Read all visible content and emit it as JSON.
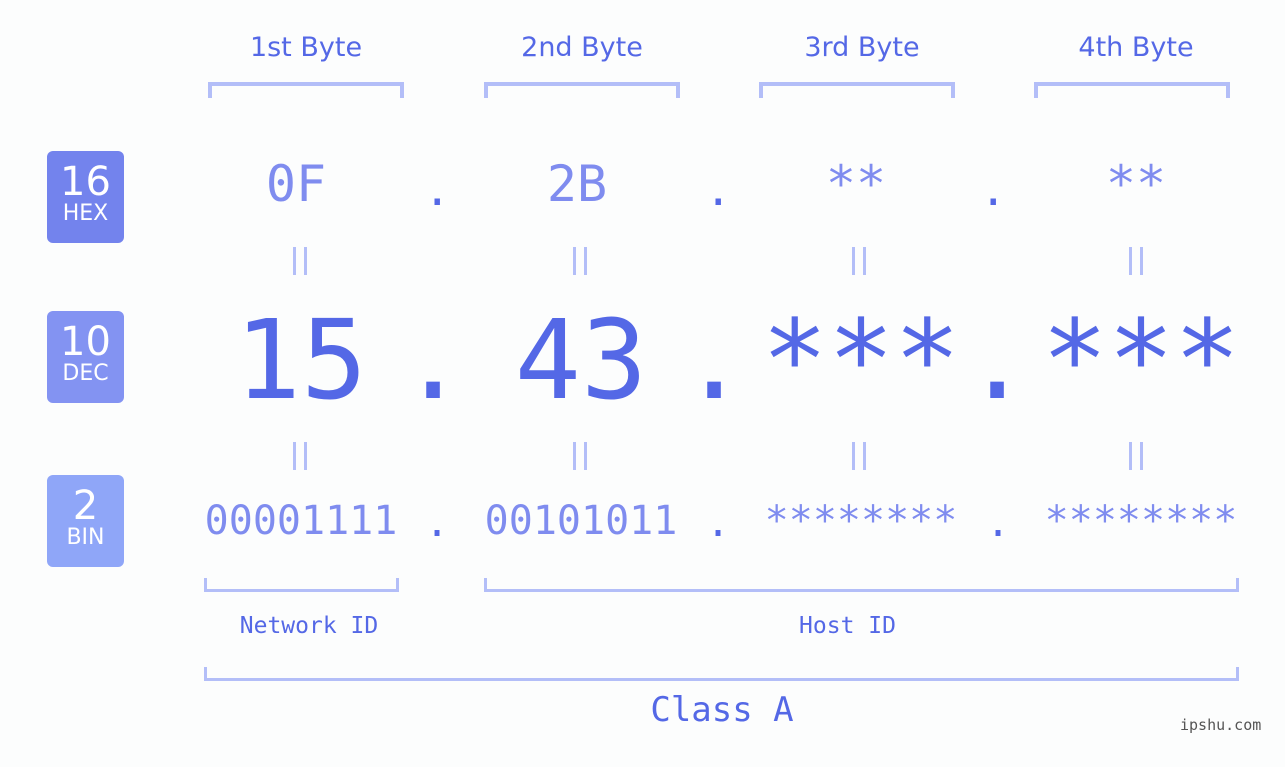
{
  "bytes": [
    {
      "header": "1st Byte",
      "hex": "0F",
      "dec": "15",
      "bin": "00001111"
    },
    {
      "header": "2nd Byte",
      "hex": "2B",
      "dec": "43",
      "bin": "00101011"
    },
    {
      "header": "3rd Byte",
      "hex": "**",
      "dec": "***",
      "bin": "********"
    },
    {
      "header": "4th Byte",
      "hex": "**",
      "dec": "***",
      "bin": "********"
    }
  ],
  "separator": ".",
  "badges": {
    "hex": {
      "num": "16",
      "label": "HEX",
      "color": "#7383ed"
    },
    "dec": {
      "num": "10",
      "label": "DEC",
      "color": "#8393f2"
    },
    "bin": {
      "num": "2",
      "label": "BIN",
      "color": "#8fa6f8"
    }
  },
  "sections": {
    "network": "Network ID",
    "host": "Host ID",
    "class": "Class A"
  },
  "watermark": "ipshu.com",
  "colors": {
    "primary": "#5468e6",
    "secondary": "#7f8cef",
    "bracket": "#b3bef8"
  }
}
